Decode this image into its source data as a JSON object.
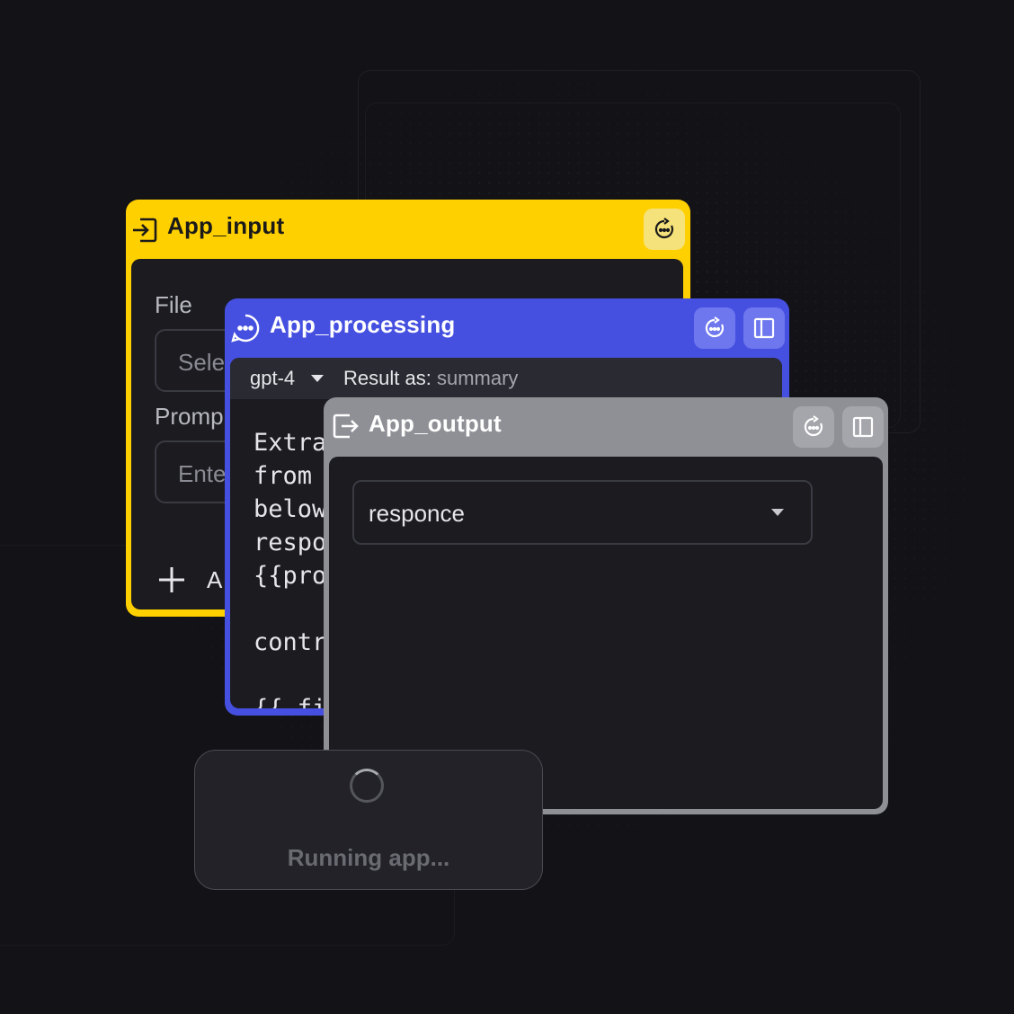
{
  "input_window": {
    "title": "App_input",
    "file_label": "File",
    "file_placeholder": "Sele",
    "prompt_label": "Promp",
    "prompt_placeholder": "Ente",
    "add_label": "A",
    "color": "#ffd000"
  },
  "processing_window": {
    "title": "App_processing",
    "model": "gpt-4",
    "result_label": "Result as:",
    "result_value": "summary",
    "code_lines": [
      "Extra",
      "from",
      "below",
      "respo",
      "{{pro",
      "",
      "contr",
      "",
      "{{ fi"
    ],
    "color": "#4650e0"
  },
  "output_window": {
    "title": "App_output",
    "select_value": "responce",
    "color": "#8f8f96"
  },
  "status": {
    "text": "Running app..."
  }
}
